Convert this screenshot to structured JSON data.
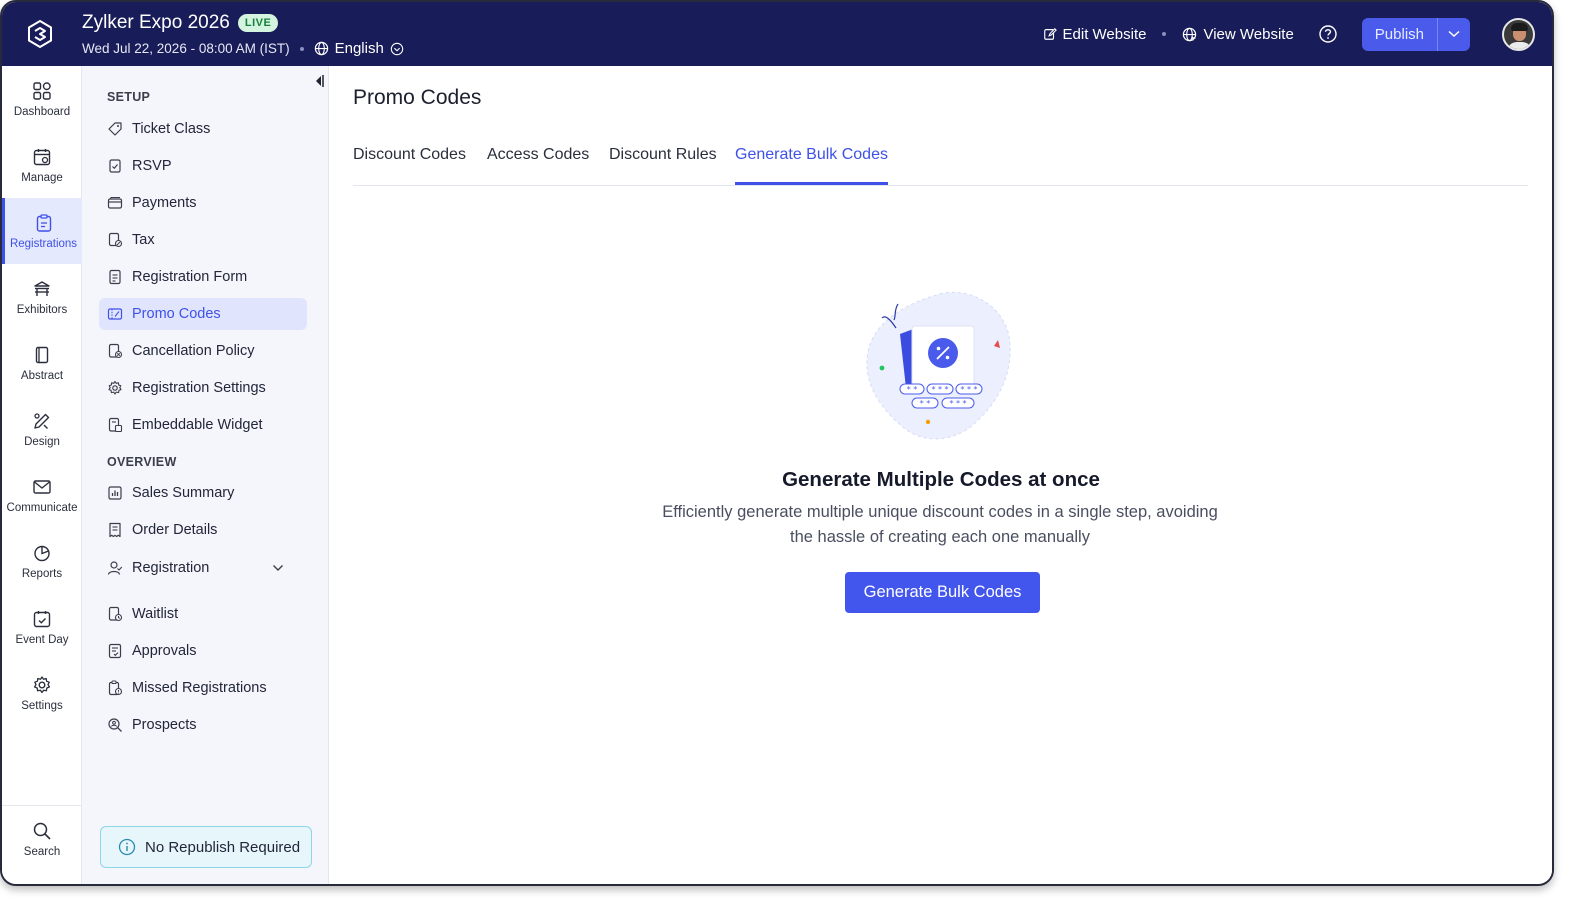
{
  "header": {
    "event_title": "Zylker Expo 2026",
    "live_badge": "LIVE",
    "event_datetime": "Wed Jul 22, 2026 - 08:00 AM (IST)",
    "language": "English",
    "edit_website": "Edit Website",
    "view_website": "View Website",
    "publish": "Publish"
  },
  "rail": {
    "items": [
      {
        "label": "Dashboard",
        "icon": "dashboard-icon"
      },
      {
        "label": "Manage",
        "icon": "manage-icon"
      },
      {
        "label": "Registrations",
        "icon": "registrations-icon",
        "active": true
      },
      {
        "label": "Exhibitors",
        "icon": "exhibitors-icon"
      },
      {
        "label": "Abstract",
        "icon": "abstract-icon"
      },
      {
        "label": "Design",
        "icon": "design-icon"
      },
      {
        "label": "Communicate",
        "icon": "communicate-icon"
      },
      {
        "label": "Reports",
        "icon": "reports-icon"
      },
      {
        "label": "Event Day",
        "icon": "event-day-icon"
      },
      {
        "label": "Settings",
        "icon": "settings-icon"
      }
    ],
    "search_label": "Search"
  },
  "subnav": {
    "setup_heading": "SETUP",
    "setup_items": [
      {
        "label": "Ticket Class"
      },
      {
        "label": "RSVP"
      },
      {
        "label": "Payments"
      },
      {
        "label": "Tax"
      },
      {
        "label": "Registration Form"
      },
      {
        "label": "Promo Codes",
        "active": true
      },
      {
        "label": "Cancellation Policy"
      },
      {
        "label": "Registration Settings"
      },
      {
        "label": "Embeddable Widget"
      }
    ],
    "overview_heading": "OVERVIEW",
    "overview_items": [
      {
        "label": "Sales Summary"
      },
      {
        "label": "Order Details"
      },
      {
        "label": "Registration"
      },
      {
        "label": "Waitlist"
      },
      {
        "label": "Approvals"
      },
      {
        "label": "Missed Registrations"
      },
      {
        "label": "Prospects"
      }
    ],
    "republish_notice": "No Republish Required"
  },
  "main": {
    "title": "Promo Codes",
    "tabs": [
      {
        "label": "Discount Codes"
      },
      {
        "label": "Access Codes"
      },
      {
        "label": "Discount Rules"
      },
      {
        "label": "Generate Bulk Codes",
        "active": true
      }
    ],
    "empty_state": {
      "title": "Generate Multiple Codes at once",
      "description": "Efficiently generate multiple unique discount codes in a single step, avoiding the hassle of creating each one manually",
      "button": "Generate Bulk Codes",
      "illustration": "bulk-codes-illustration"
    }
  },
  "colors": {
    "topbar": "#181c58",
    "accent": "#4255ec",
    "live_badge_bg": "#d4f4df",
    "live_badge_text": "#15803d",
    "active_nav_bg": "#e0e5fd"
  }
}
